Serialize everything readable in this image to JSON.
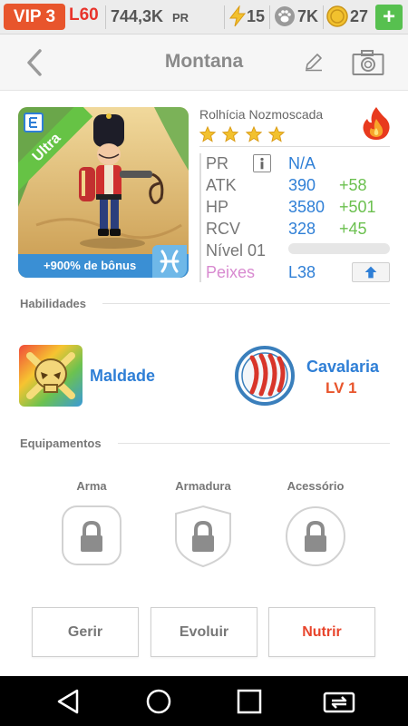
{
  "topbar": {
    "vip": "VIP 3",
    "level": "L60",
    "power_value": "744,3K",
    "power_unit": "PR",
    "energy": "15",
    "paws": "7K",
    "coins": "27",
    "plus": "+"
  },
  "header": {
    "title": "Montana"
  },
  "hero": {
    "ribbon": "Ultra",
    "bonus": "+900% de bônus",
    "name": "Rolhícia Nozmoscada",
    "stars": 4,
    "stats": {
      "pr_label": "PR",
      "pr_value": "N/A",
      "atk_label": "ATK",
      "atk_value": "390",
      "atk_plus": "+58",
      "hp_label": "HP",
      "hp_value": "3580",
      "hp_plus": "+501",
      "rcv_label": "RCV",
      "rcv_value": "328",
      "rcv_plus": "+45",
      "level_label": "Nível 01",
      "level_progress": 0.0,
      "fish_label": "Peixes",
      "fish_value": "L38"
    }
  },
  "skills": {
    "title": "Habilidades",
    "skill1": "Maldade",
    "skill2": "Cavalaria",
    "skill2_level": "LV 1"
  },
  "equipment": {
    "title": "Equipamentos",
    "slot1": "Arma",
    "slot2": "Armadura",
    "slot3": "Acessório"
  },
  "actions": {
    "manage": "Gerir",
    "evolve": "Evoluir",
    "feed": "Nutrir"
  },
  "colors": {
    "accent_blue": "#2f7fd6",
    "bonus_green": "#6bc04f",
    "vip_orange": "#e8552c",
    "fish_pink": "#d88ad0"
  },
  "icons": {
    "energy": "lightning-icon",
    "paws": "paw-icon",
    "coins": "coin-icon",
    "edit": "pencil-icon",
    "camera": "camera-icon",
    "element": "fire-icon",
    "zodiac": "pisces-icon"
  }
}
